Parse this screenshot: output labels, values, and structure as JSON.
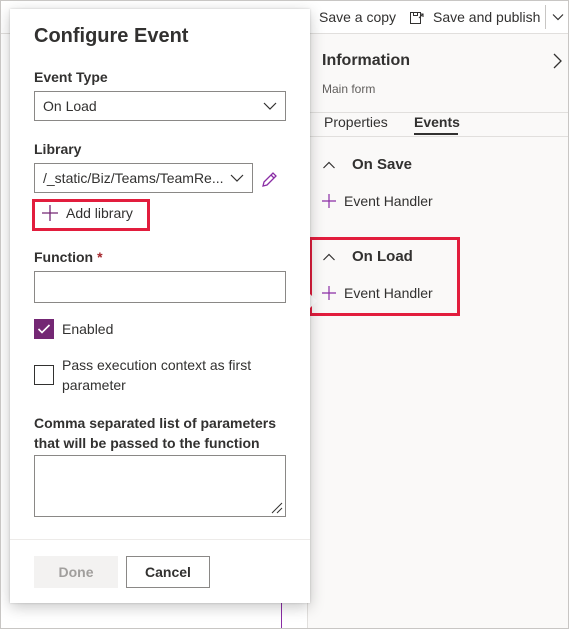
{
  "toolbar": {
    "save_copy_label": "Save a copy",
    "save_publish_label": "Save and publish"
  },
  "panel": {
    "title": "Information",
    "subtitle": "Main form",
    "tabs": [
      {
        "label": "Properties",
        "active": false
      },
      {
        "label": "Events",
        "active": true
      }
    ],
    "sections": [
      {
        "title": "On Save",
        "handler_label": "Event Handler"
      },
      {
        "title": "On Load",
        "handler_label": "Event Handler"
      }
    ]
  },
  "dialog": {
    "title": "Configure Event",
    "event_type": {
      "label": "Event Type",
      "value": "On Load"
    },
    "library": {
      "label": "Library",
      "value": "/_static/Biz/Teams/TeamRe..."
    },
    "add_library_label": "Add library",
    "function": {
      "label": "Function",
      "required_mark": "*",
      "value": ""
    },
    "enabled": {
      "label": "Enabled",
      "checked": true
    },
    "pass_context": {
      "label": "Pass execution context as first parameter",
      "checked": false
    },
    "parameters": {
      "label": "Comma separated list of parameters that will be passed to the function",
      "value": ""
    },
    "done_label": "Done",
    "cancel_label": "Cancel"
  },
  "colors": {
    "accent": "#742774",
    "highlight": "#e21d3d",
    "required": "#a4262c"
  },
  "icons": {
    "save_copy": "save-copy-icon",
    "save_publish": "save-publish-icon",
    "edit": "pencil-icon",
    "add": "plus-icon"
  }
}
